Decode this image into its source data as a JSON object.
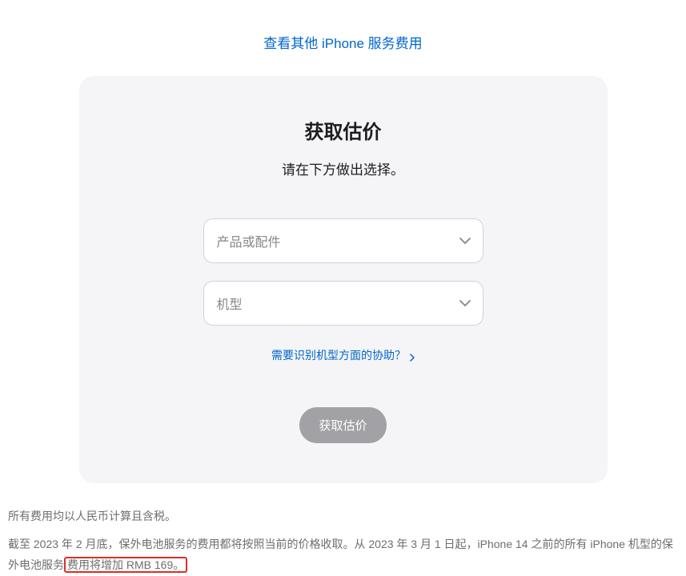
{
  "topLink": {
    "label": "查看其他 iPhone 服务费用"
  },
  "card": {
    "title": "获取估价",
    "subtitle": "请在下方做出选择。",
    "productSelect": {
      "placeholder": "产品或配件"
    },
    "modelSelect": {
      "placeholder": "机型"
    },
    "helpLink": {
      "label": "需要识别机型方面的协助？"
    },
    "submit": {
      "label": "获取估价"
    }
  },
  "footer": {
    "note1": "所有费用均以人民币计算且含税。",
    "note2_prefix": "截至 2023 年 2 月底，保外电池服务的费用都将按照当前的价格收取。从 2023 年 3 月 1 日起，iPhone 14 之前的所有 iPhone 机型的保外电池服务",
    "note2_highlight": "费用将增加 RMB 169。"
  }
}
